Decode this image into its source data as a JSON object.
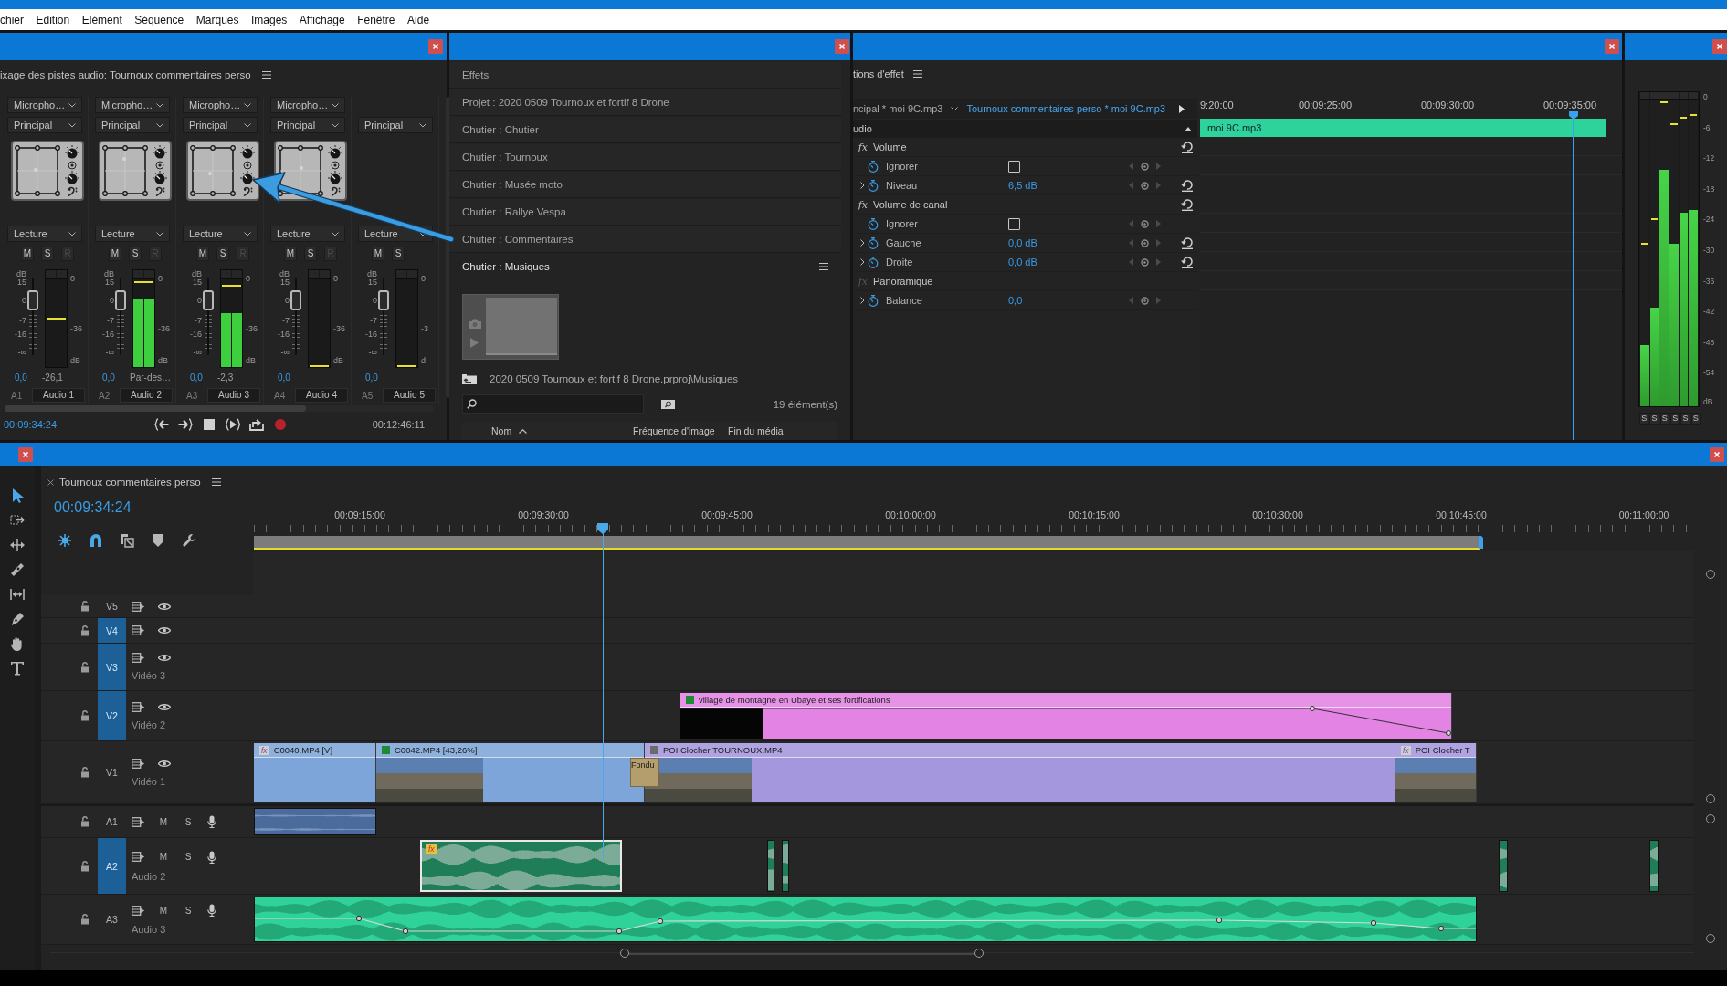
{
  "menu_bar": {
    "items": [
      "chier",
      "Edition",
      "Elément",
      "Séquence",
      "Marques",
      "Images",
      "Affichage",
      "Fenêtre",
      "Aide"
    ]
  },
  "audio_mixer": {
    "title": "ixage des pistes audio: Tournoux commentaires perso",
    "channels": [
      {
        "input": "Micropho…",
        "output": "Principal",
        "panner": true,
        "mode": "Lecture",
        "buttons": [
          {
            "label": "M",
            "disabled": false
          },
          {
            "label": "S",
            "disabled": false
          },
          {
            "label": "R",
            "disabled": true
          }
        ],
        "fader_scale": [
          "dB",
          "15",
          "0",
          "-7",
          "-16",
          "-∞"
        ],
        "fader": {
          "level": 0.7
        },
        "peak_hold": {
          "level": 0.55
        },
        "meter_scale": [
          "0",
          "-36",
          "dB"
        ],
        "volume": "0,0",
        "peak": "-26,1",
        "track": "A1",
        "name": "Audio 1"
      },
      {
        "input": "Micropho…",
        "output": "Principal",
        "panner": true,
        "mode": "Lecture",
        "buttons": [
          {
            "label": "M",
            "disabled": false
          },
          {
            "label": "S",
            "disabled": false
          },
          {
            "label": "R",
            "disabled": true
          }
        ],
        "fader_scale": [
          "dB",
          "15",
          "0",
          "-7",
          "-16",
          "-∞"
        ],
        "fader": {
          "level": 0.7
        },
        "meter": {
          "level": 0.78
        },
        "peak_hold": {
          "level": 0.97
        },
        "meter_scale": [
          "0",
          "-36",
          "dB"
        ],
        "volume": "0,0",
        "peak": "Par-des…",
        "track": "A2",
        "name": "Audio 2"
      },
      {
        "input": "Micropho…",
        "output": "Principal",
        "panner": true,
        "mode": "Lecture",
        "buttons": [
          {
            "label": "M",
            "disabled": false
          },
          {
            "label": "S",
            "disabled": false
          },
          {
            "label": "R",
            "disabled": true
          }
        ],
        "fader_scale": [
          "dB",
          "15",
          "0",
          "-7",
          "-16",
          "-∞"
        ],
        "fader": {
          "level": 0.7
        },
        "meter": {
          "level": 0.61
        },
        "peak_hold": {
          "level": 0.93
        },
        "meter_scale": [
          "0",
          "-36",
          "dB"
        ],
        "volume": "0,0",
        "peak": "-2,3",
        "track": "A3",
        "name": "Audio 3"
      },
      {
        "input": "Micropho…",
        "output": "Principal",
        "panner": true,
        "mode": "Lecture",
        "buttons": [
          {
            "label": "M",
            "disabled": false
          },
          {
            "label": "S",
            "disabled": false
          },
          {
            "label": "R",
            "disabled": true
          }
        ],
        "fader_scale": [
          "dB",
          "15",
          "0",
          "-7",
          "-16",
          "-∞"
        ],
        "fader": {
          "level": 0.7
        },
        "peak_hold": {
          "level": 0.01
        },
        "meter_scale": [
          "0",
          "-36",
          "dB"
        ],
        "volume": "0,0",
        "track": "A4",
        "name": "Audio 4"
      },
      {
        "output": "Principal",
        "panner": false,
        "mode": "Lecture",
        "buttons": [
          {
            "label": "M",
            "disabled": false
          },
          {
            "label": "S",
            "disabled": false
          }
        ],
        "fader_scale": [
          "dB",
          "15",
          "0",
          "-7",
          "-16",
          "-∞"
        ],
        "fader": {
          "level": 0.7
        },
        "peak_hold": {
          "level": 0.01
        },
        "meter_scale": [
          "0",
          "-3",
          "d"
        ],
        "volume": "0,0",
        "track": "A5",
        "name": "Audio 5"
      }
    ],
    "time": "00:09:34:24",
    "transport": [
      {
        "kind": "go-in"
      },
      {
        "kind": "go-out"
      },
      {
        "kind": "stop"
      },
      {
        "kind": "play-in-out"
      },
      {
        "kind": "loop"
      },
      {
        "kind": "record"
      }
    ],
    "duration": "00:12:46:11"
  },
  "project_panel": {
    "tabs": [
      {
        "label": "Effets",
        "selected": false
      },
      {
        "label": "Projet : 2020 0509 Tournoux et fortif 8 Drone",
        "selected": false
      },
      {
        "label": "Chutier : Chutier",
        "selected": false
      },
      {
        "label": "Chutier : Tournoux",
        "selected": false
      },
      {
        "label": "Chutier : Musée moto",
        "selected": false
      },
      {
        "label": "Chutier : Rallye Vespa",
        "selected": false
      },
      {
        "label": "Chutier : Commentaires",
        "selected": false
      },
      {
        "label": "Chutier : Musiques",
        "selected": true
      }
    ],
    "path": "2020 0509 Tournoux et fortif 8 Drone.prproj\\Musiques",
    "count": "19 élément(s)",
    "columns": [
      {
        "label": "Nom",
        "sorted": true
      },
      {
        "label": "Fréquence d'image",
        "sorted": false
      },
      {
        "label": "Fin du média",
        "sorted": false
      }
    ]
  },
  "effect_controls": {
    "title": "tions d'effet",
    "sources": [
      {
        "label": "ncipal * moi 9C.mp3",
        "selected": false
      },
      {
        "label": "Tournoux commentaires perso * moi 9C.mp3",
        "selected": true
      }
    ],
    "section": "udio",
    "rows": [
      {
        "kind": "effect",
        "fx": "fx",
        "label": "Volume",
        "enabled": true,
        "reset": true
      },
      {
        "kind": "checkbox",
        "label": "Ignorer",
        "checked": false,
        "reset": false
      },
      {
        "kind": "value",
        "label": "Niveau",
        "value": "6,5 dB",
        "reset": true
      },
      {
        "kind": "effect",
        "fx": "fx",
        "label": "Volume de canal",
        "enabled": true,
        "reset": true
      },
      {
        "kind": "checkbox",
        "label": "Ignorer",
        "checked": false,
        "reset": false
      },
      {
        "kind": "value",
        "label": "Gauche",
        "value": "0,0 dB",
        "reset": true
      },
      {
        "kind": "value",
        "label": "Droite",
        "value": "0,0 dB",
        "reset": true
      },
      {
        "kind": "effect",
        "fx": "fx",
        "label": "Panoramique",
        "enabled": false,
        "reset": false
      },
      {
        "kind": "value",
        "label": "Balance",
        "value": "0,0",
        "reset": false
      }
    ],
    "ruler": [
      "9:20:00",
      "00:09:25:00",
      "00:09:30:00",
      "00:09:35:00"
    ],
    "clip": "moi 9C.mp3"
  },
  "audio_meters": {
    "scale": [
      "0",
      "-6",
      "-12",
      "-18",
      "-24",
      "-30",
      "-36",
      "-42",
      "-48",
      "-54",
      "dB"
    ],
    "channels": [
      {
        "meter": {
          "level": 0.2
        },
        "peak_hold": {
          "level": 0.53
        },
        "solo": "S"
      },
      {
        "meter": {
          "level": 0.32
        },
        "peak_hold": {
          "level": 0.61
        },
        "solo": "S"
      },
      {
        "meter": {
          "level": 0.77
        },
        "peak_hold": {
          "level": 0.99
        },
        "solo": "S"
      },
      {
        "meter": {
          "level": 0.53
        },
        "peak_hold": {
          "level": 0.92
        },
        "solo": "S"
      },
      {
        "meter": {
          "level": 0.63
        },
        "peak_hold": {
          "level": 0.94
        },
        "solo": "S"
      },
      {
        "meter": {
          "level": 0.64
        },
        "peak_hold": {
          "level": 0.95
        },
        "solo": "S"
      }
    ]
  },
  "timeline": {
    "tab": "Tournoux commentaires perso",
    "timecode": "00:09:34:24",
    "tools": [
      {
        "kind": "selection",
        "selected": true
      },
      {
        "kind": "track-select",
        "selected": false
      },
      {
        "kind": "ripple",
        "selected": false
      },
      {
        "kind": "razor",
        "selected": false
      },
      {
        "kind": "slip",
        "selected": false
      },
      {
        "kind": "pen",
        "selected": false
      },
      {
        "kind": "hand",
        "selected": false
      },
      {
        "kind": "type",
        "selected": false
      }
    ],
    "buttons": [
      {
        "kind": "nest",
        "on": true
      },
      {
        "kind": "snap",
        "on": true
      },
      {
        "kind": "linked",
        "on": false
      },
      {
        "kind": "marker",
        "on": false
      },
      {
        "kind": "settings",
        "on": false
      }
    ],
    "ruler": [
      "00:09:15:00",
      "00:09:30:00",
      "00:09:45:00",
      "00:10:00:00",
      "00:10:15:00",
      "00:10:30:00",
      "00:10:45:00",
      "00:11:00:00"
    ],
    "tracks": [
      {
        "kind": "video",
        "id": "V5",
        "targeted": false,
        "locked": false
      },
      {
        "kind": "video",
        "id": "V4",
        "targeted": true,
        "locked": false
      },
      {
        "kind": "video",
        "id": "V3",
        "name": "Vidéo 3",
        "targeted": true,
        "locked": false
      },
      {
        "kind": "video",
        "id": "V2",
        "name": "Vidéo 2",
        "targeted": true,
        "locked": false,
        "clips": [
          {
            "kind": "video",
            "label": "village de montagne en Ubaye et ses fortifications",
            "color": "#e383e3",
            "badge": {
              "kind": "swatch",
              "color": "#1d8a36"
            },
            "thumbnail": {
              "kind": "black"
            },
            "keyframes": true,
            "selected": false
          }
        ]
      },
      {
        "kind": "video",
        "id": "V1",
        "name": "Vidéo 1",
        "targeted": false,
        "locked": false,
        "clips": [
          {
            "kind": "video",
            "label": "C0040.MP4 [V]",
            "color": "#7ea5d9",
            "badge": {
              "kind": "fx",
              "text": "fx"
            },
            "keyframes": false,
            "selected": false
          },
          {
            "kind": "video",
            "label": "C0042.MP4 [43,26%]",
            "color": "#7ea5d9",
            "badge": {
              "kind": "swatch",
              "color": "#1d8a36"
            },
            "thumbnail": {
              "kind": "photo"
            },
            "keyframes": false,
            "selected": false
          },
          {
            "kind": "transition",
            "label": "Fondu",
            "color": "#b59e6e",
            "selected": false
          },
          {
            "kind": "video",
            "label": "POI Clocher TOURNOUX.MP4",
            "color": "#a497de",
            "badge": {
              "kind": "swatch",
              "color": "#6b6b6b"
            },
            "thumbnail": {
              "kind": "photo"
            },
            "keyframes": false,
            "selected": false
          },
          {
            "kind": "video",
            "label": "POI Clocher T",
            "color": "#a497de",
            "badge": {
              "kind": "fx",
              "text": "fx"
            },
            "thumbnail": {
              "kind": "photo"
            },
            "keyframes": false,
            "selected": false
          }
        ]
      },
      {
        "kind": "audio",
        "id": "A1",
        "buttons": [
          "M",
          "S"
        ],
        "targeted": false,
        "locked": false,
        "clips": [
          {
            "kind": "audio",
            "color": "#4b6b9c",
            "keyframes": false,
            "selected": false
          }
        ]
      },
      {
        "kind": "audio",
        "id": "A2",
        "name": "Audio 2",
        "buttons": [
          "M",
          "S"
        ],
        "targeted": true,
        "locked": false,
        "clips": [
          {
            "kind": "audio",
            "color": "#1f7d58",
            "badge": {
              "kind": "fx",
              "text": "fx"
            },
            "keyframes": false,
            "selected": true
          },
          {
            "kind": "audio",
            "color": "#1f7d58",
            "keyframes": false,
            "selected": false
          },
          {
            "kind": "audio",
            "color": "#1f7d58",
            "keyframes": false,
            "selected": false
          },
          {
            "kind": "audio",
            "color": "#1f7d58",
            "keyframes": false,
            "selected": false
          },
          {
            "kind": "audio",
            "color": "#1f7d58",
            "keyframes": false,
            "selected": false
          }
        ]
      },
      {
        "kind": "audio",
        "id": "A3",
        "name": "Audio 3",
        "buttons": [
          "M",
          "S"
        ],
        "targeted": false,
        "locked": false,
        "clips": [
          {
            "kind": "audio",
            "color": "#2fd39a",
            "keyframes": true,
            "selected": false
          }
        ]
      }
    ]
  }
}
